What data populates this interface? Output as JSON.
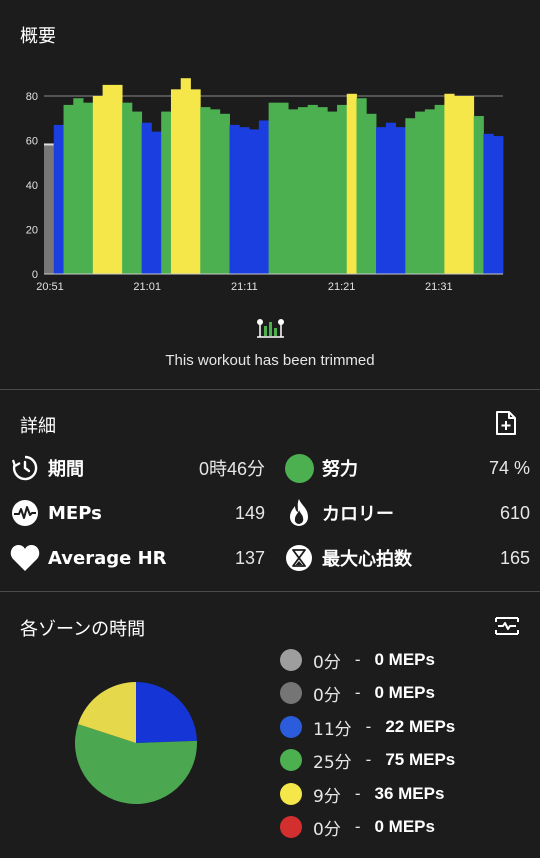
{
  "overview": {
    "title": "概要",
    "trim_message": "This workout has been trimmed"
  },
  "chart_data": {
    "type": "bar",
    "ylim": [
      0,
      80
    ],
    "y_ticks": [
      "0",
      "20",
      "40",
      "60",
      "80"
    ],
    "x_ticks": [
      "20:51",
      "21:01",
      "21:11",
      "21:21",
      "21:31"
    ],
    "zone_colors": {
      "gray": "#777777",
      "blue": "#1a3ee0",
      "green": "#4caf50",
      "yellow": "#f5e64a"
    },
    "values": [
      58,
      67,
      76,
      79,
      77,
      80,
      85,
      85,
      77,
      73,
      68,
      64,
      73,
      83,
      88,
      83,
      75,
      74,
      72,
      67,
      66,
      65,
      69,
      77,
      77,
      74,
      75,
      76,
      75,
      73,
      76,
      81,
      79,
      72,
      66,
      68,
      66,
      70,
      73,
      74,
      76,
      81,
      80,
      80,
      71,
      63,
      62
    ],
    "zones": [
      "gray",
      "blue",
      "green",
      "green",
      "green",
      "yellow",
      "yellow",
      "yellow",
      "green",
      "green",
      "blue",
      "blue",
      "green",
      "yellow",
      "yellow",
      "yellow",
      "green",
      "green",
      "green",
      "blue",
      "blue",
      "blue",
      "blue",
      "green",
      "green",
      "green",
      "green",
      "green",
      "green",
      "green",
      "green",
      "yellow",
      "green",
      "green",
      "blue",
      "blue",
      "blue",
      "green",
      "green",
      "green",
      "green",
      "yellow",
      "yellow",
      "yellow",
      "green",
      "blue",
      "blue"
    ]
  },
  "details": {
    "title": "詳細",
    "stats": [
      {
        "label": "期間",
        "value": "0時46分"
      },
      {
        "label": "努力",
        "value": "74 %"
      },
      {
        "label": "MEPs",
        "value": "149"
      },
      {
        "label": "カロリー",
        "value": "610"
      },
      {
        "label": "Average HR",
        "value": "137"
      },
      {
        "label": "最大心拍数",
        "value": "165"
      }
    ]
  },
  "zones": {
    "title": "各ゾーンの時間",
    "legend": [
      {
        "minutes": "0分",
        "meps": "0 MEPs",
        "color": "#9e9e9e"
      },
      {
        "minutes": "0分",
        "meps": "0 MEPs",
        "color": "#757575"
      },
      {
        "minutes": "11分",
        "meps": "22 MEPs",
        "color": "#2a5cdc"
      },
      {
        "minutes": "25分",
        "meps": "75 MEPs",
        "color": "#4caf50"
      },
      {
        "minutes": "9分",
        "meps": "36 MEPs",
        "color": "#f5e64a"
      },
      {
        "minutes": "0分",
        "meps": "0 MEPs",
        "color": "#d32f2f"
      }
    ],
    "pie": [
      {
        "value": 11,
        "color": "#1535d6"
      },
      {
        "value": 25,
        "color": "#4ca850"
      },
      {
        "value": 9,
        "color": "#e5d84a"
      }
    ]
  }
}
